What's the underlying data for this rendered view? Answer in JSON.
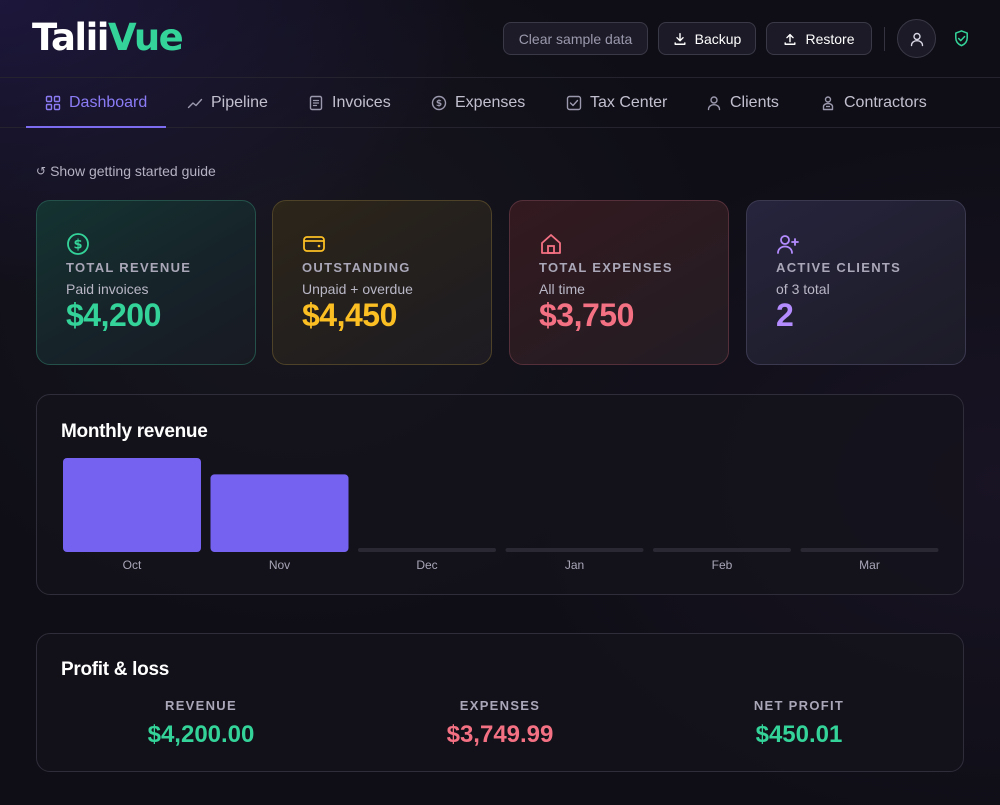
{
  "app": {
    "logo_part1": "Talii",
    "logo_part2": "Vue"
  },
  "header": {
    "clear_label": "Clear sample data",
    "backup_label": "Backup",
    "restore_label": "Restore"
  },
  "nav": {
    "tabs": [
      {
        "label": "Dashboard",
        "icon": "grid-icon",
        "active": true
      },
      {
        "label": "Pipeline",
        "icon": "trend-icon"
      },
      {
        "label": "Invoices",
        "icon": "document-icon"
      },
      {
        "label": "Expenses",
        "icon": "dollar-circle-icon"
      },
      {
        "label": "Tax Center",
        "icon": "checkbox-icon"
      },
      {
        "label": "Clients",
        "icon": "user-icon"
      },
      {
        "label": "Contractors",
        "icon": "worker-icon"
      }
    ]
  },
  "guide": {
    "label": "Show getting started guide"
  },
  "stats": [
    {
      "title": "TOTAL REVENUE",
      "subtitle": "Paid invoices",
      "value": "$4,200",
      "icon": "dollar-circle-icon",
      "color": "#34d399"
    },
    {
      "title": "OUTSTANDING",
      "subtitle": "Unpaid + overdue",
      "value": "$4,450",
      "icon": "wallet-icon",
      "color": "#fbbf24"
    },
    {
      "title": "TOTAL EXPENSES",
      "subtitle": "All time",
      "value": "$3,750",
      "icon": "home-icon",
      "color": "#f47183"
    },
    {
      "title": "ACTIVE CLIENTS",
      "subtitle": "of 3 total",
      "value": "2",
      "icon": "user-plus-icon",
      "color": "#b48cff"
    }
  ],
  "chart_data": {
    "type": "bar",
    "title": "Monthly revenue",
    "categories": [
      "Oct",
      "Nov",
      "Dec",
      "Jan",
      "Feb",
      "Mar"
    ],
    "values": [
      2300,
      1900,
      0,
      0,
      0,
      0
    ],
    "ylim": [
      0,
      2300
    ],
    "bar_color": "#7562f0"
  },
  "pnl": {
    "title": "Profit & loss",
    "revenue_label": "REVENUE",
    "revenue_value": "$4,200.00",
    "expenses_label": "EXPENSES",
    "expenses_value": "$3,749.99",
    "profit_label": "NET PROFIT",
    "profit_value": "$450.01"
  },
  "colors": {
    "accent": "#7c6cf0",
    "green": "#34d399",
    "red": "#f47183",
    "amber": "#fbbf24",
    "purple": "#b48cff"
  }
}
